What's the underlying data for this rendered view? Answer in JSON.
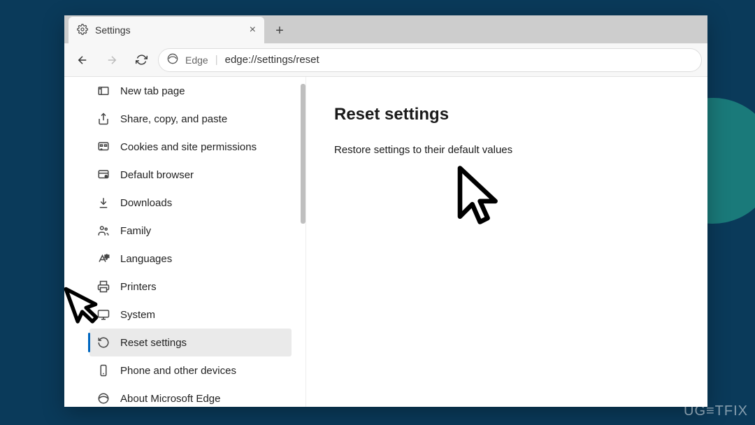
{
  "tab": {
    "title": "Settings"
  },
  "toolbar": {
    "edge_label": "Edge",
    "url": "edge://settings/reset"
  },
  "sidebar": {
    "items": [
      {
        "icon": "new-tab-icon",
        "label": "New tab page"
      },
      {
        "icon": "share-icon",
        "label": "Share, copy, and paste"
      },
      {
        "icon": "cookies-icon",
        "label": "Cookies and site permissions"
      },
      {
        "icon": "default-browser-icon",
        "label": "Default browser"
      },
      {
        "icon": "download-icon",
        "label": "Downloads"
      },
      {
        "icon": "family-icon",
        "label": "Family"
      },
      {
        "icon": "languages-icon",
        "label": "Languages"
      },
      {
        "icon": "printer-icon",
        "label": "Printers"
      },
      {
        "icon": "system-icon",
        "label": "System"
      },
      {
        "icon": "reset-icon",
        "label": "Reset settings",
        "selected": true
      },
      {
        "icon": "phone-icon",
        "label": "Phone and other devices"
      },
      {
        "icon": "edge-icon",
        "label": "About Microsoft Edge"
      }
    ]
  },
  "main": {
    "title": "Reset settings",
    "subtitle": "Restore settings to their default values"
  },
  "watermark": "UG≡TFIX"
}
